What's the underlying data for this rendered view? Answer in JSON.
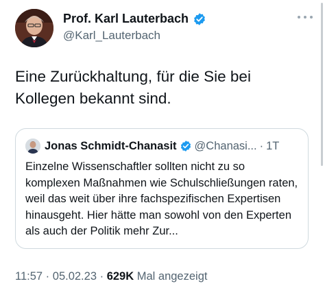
{
  "author": {
    "name": "Prof. Karl Lauterbach",
    "handle": "@Karl_Lauterbach",
    "verified": true
  },
  "tweet": {
    "text": "Eine Zurückhaltung, für die Sie bei Kollegen bekannt sind."
  },
  "quoted_tweet": {
    "author_name": "Jonas Schmidt-Chanasit",
    "handle": "@Chanasi...",
    "separator": "·",
    "time": "1T",
    "text": "Einzelne Wissenschaftler sollten nicht zu so komplexen Maßnahmen wie Schulschließungen raten, weil das weit über ihre fachspezifischen Expertisen hinausgeht. Hier hätte man sowohl von den Experten als auch der Politik mehr Zur..."
  },
  "meta": {
    "time": "11:57",
    "date": "05.02.23",
    "separator": "·",
    "views_count": "629K",
    "views_label": "Mal angezeigt"
  },
  "colors": {
    "verified_blue": "#1d9bf0",
    "secondary_text": "#536471",
    "primary_text": "#0f1419",
    "border": "#cfd9de"
  },
  "icons": {
    "verified": "verified-badge-icon",
    "more": "more-horizontal-icon"
  }
}
